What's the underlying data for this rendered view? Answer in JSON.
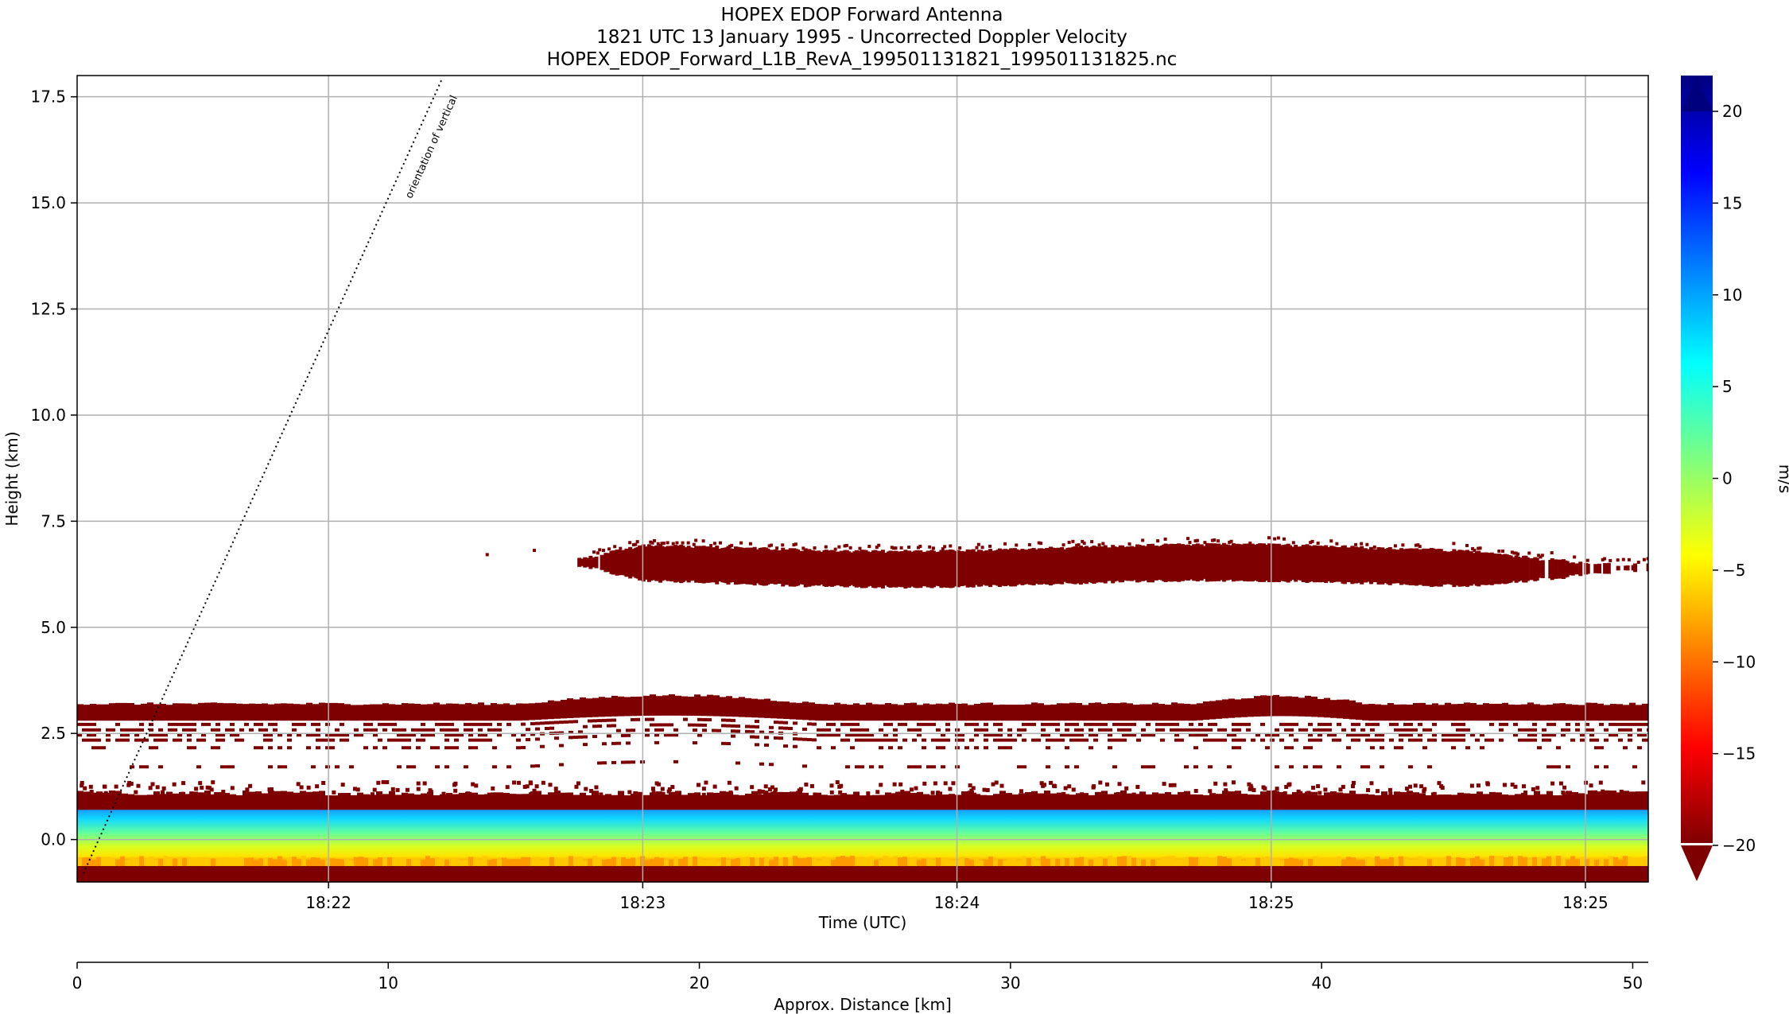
{
  "chart_data": {
    "type": "heatmap",
    "title_lines": [
      "HOPEX EDOP Forward Antenna",
      "1821 UTC 13 January 1995 - Uncorrected Doppler Velocity",
      "HOPEX_EDOP_Forward_L1B_RevA_199501131821_199501131825.nc"
    ],
    "ylabel": "Height (km)",
    "xlabel": "Time (UTC)",
    "x2label": "Approx. Distance [km]",
    "ylim": [
      -1.0,
      18.0
    ],
    "y_ticks": [
      {
        "v": 0.0,
        "label": "0.0"
      },
      {
        "v": 2.5,
        "label": "2.5"
      },
      {
        "v": 5.0,
        "label": "5.0"
      },
      {
        "v": 7.5,
        "label": "7.5"
      },
      {
        "v": 10.0,
        "label": "10.0"
      },
      {
        "v": 12.5,
        "label": "12.5"
      },
      {
        "v": 15.0,
        "label": "15.0"
      },
      {
        "v": 17.5,
        "label": "17.5"
      }
    ],
    "xlim_min": [
      21.2,
      26.2
    ],
    "x_ticks": [
      {
        "v": 22,
        "label": "18:22"
      },
      {
        "v": 23,
        "label": "18:23"
      },
      {
        "v": 24,
        "label": "18:24"
      },
      {
        "v": 25,
        "label": "18:25"
      },
      {
        "v": 26,
        "label": "18:25"
      }
    ],
    "x2lim": [
      0,
      50.5
    ],
    "x2_ticks": [
      {
        "v": 0,
        "label": "0"
      },
      {
        "v": 10,
        "label": "10"
      },
      {
        "v": 20,
        "label": "20"
      },
      {
        "v": 30,
        "label": "30"
      },
      {
        "v": 40,
        "label": "40"
      },
      {
        "v": 50,
        "label": "50"
      }
    ],
    "grid": true,
    "colorbar": {
      "label": "m/s",
      "vmin": -20,
      "vmax": 20,
      "extend": "both",
      "ticks": [
        {
          "v": 20,
          "label": "20"
        },
        {
          "v": 15,
          "label": "15"
        },
        {
          "v": 10,
          "label": "10"
        },
        {
          "v": 5,
          "label": "5"
        },
        {
          "v": 0,
          "label": "0"
        },
        {
          "v": -5,
          "label": "−5"
        },
        {
          "v": -10,
          "label": "−10"
        },
        {
          "v": -15,
          "label": "−15"
        },
        {
          "v": -20,
          "label": "−20"
        }
      ],
      "colormap": [
        "#7f0000",
        "#ff0000",
        "#ff7f00",
        "#ffff00",
        "#7fff7f",
        "#00ffff",
        "#007fff",
        "#0000ff",
        "#00007f"
      ]
    },
    "annotation": {
      "text": "orientation of vertical",
      "line_from": {
        "time_min": 21.22,
        "height_km": -0.8
      },
      "line_to": {
        "time_min": 22.36,
        "height_km": 17.9
      }
    },
    "echo_layers": [
      {
        "name": "surface band",
        "from_km": -1.0,
        "to_km": -0.55,
        "velocity": -20
      },
      {
        "name": "near-surface band",
        "from_km": -0.55,
        "to_km": 0.75,
        "velocity_range": [
          -12,
          8
        ]
      },
      {
        "name": "lower layer",
        "from_km": 0.7,
        "to_km": 1.1,
        "velocity": -20
      },
      {
        "name": "upper layer",
        "from_km": 2.8,
        "to_km": 3.2,
        "velocity": -20
      },
      {
        "name": "mid-level layer",
        "from_km": 6.0,
        "to_km": 6.9,
        "start_min": 22.75,
        "end_min": 26.2,
        "velocity": -20
      }
    ]
  }
}
